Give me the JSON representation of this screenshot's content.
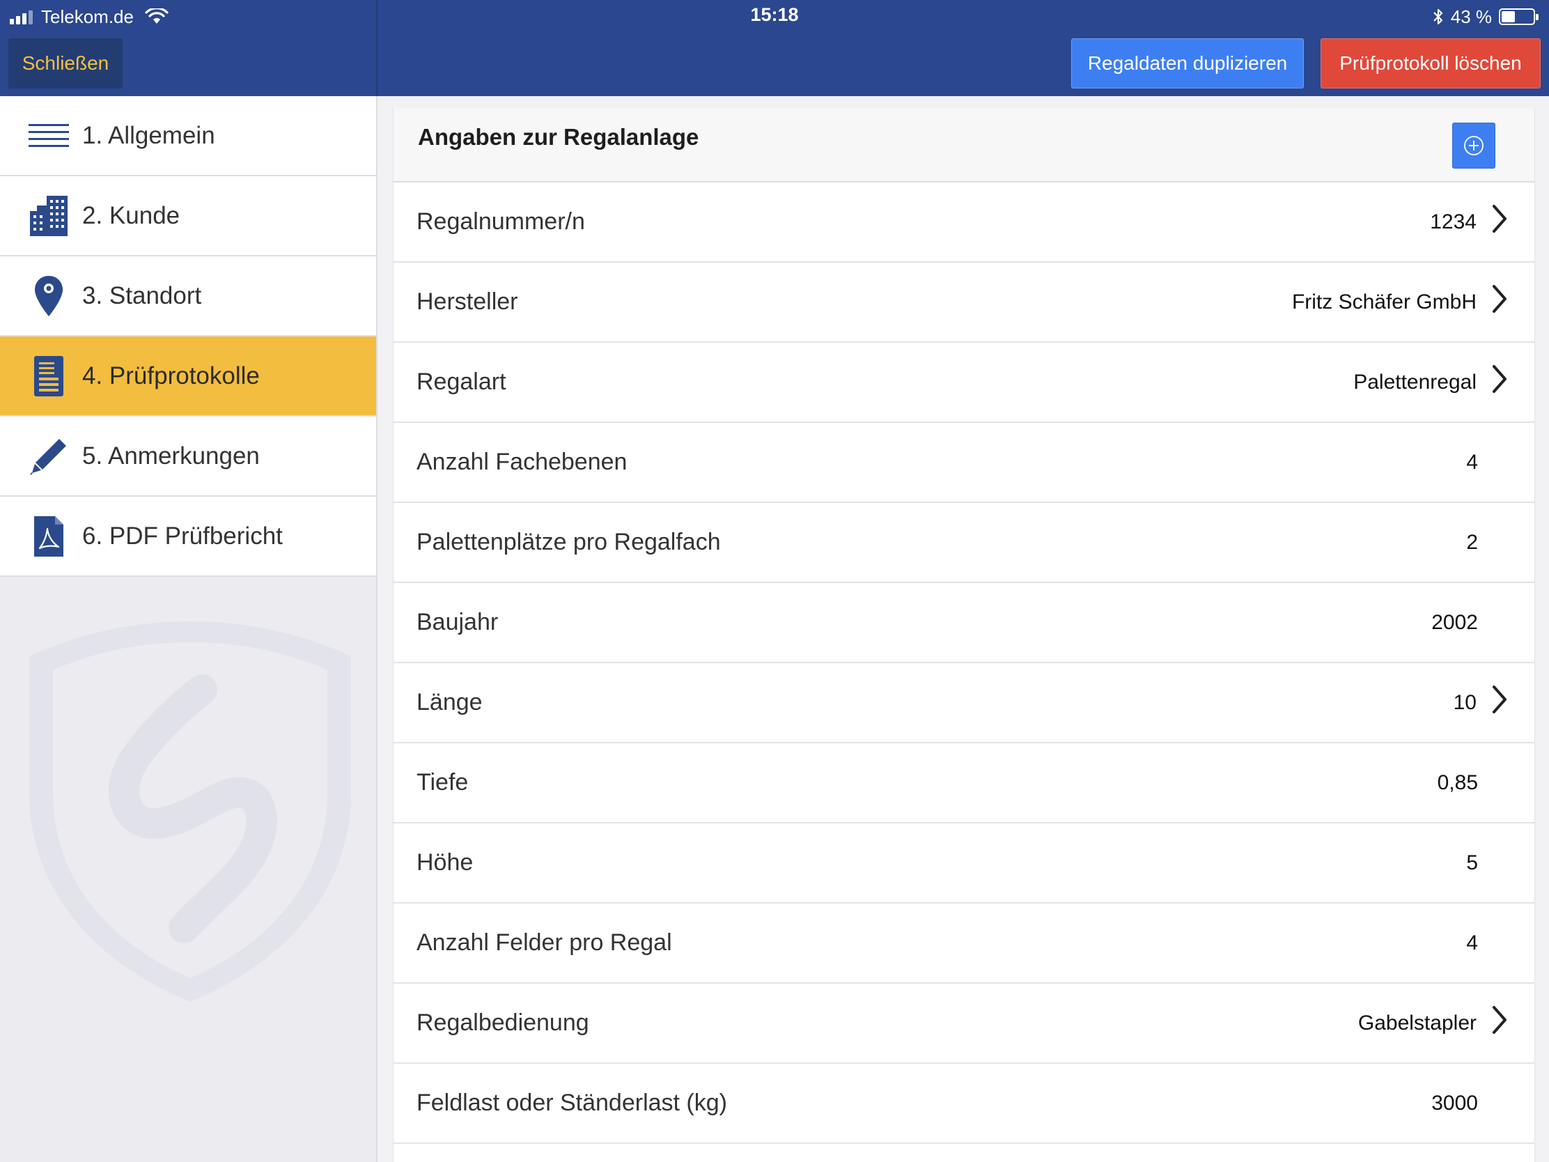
{
  "status_bar": {
    "carrier": "Telekom.de",
    "time": "15:18",
    "battery_text": "43 %",
    "battery_level": 0.43,
    "icons": [
      "signal-icon",
      "wifi-icon",
      "bluetooth-icon",
      "battery-icon"
    ]
  },
  "header": {
    "close_label": "Schließen",
    "duplicate_label": "Regaldaten duplizieren",
    "delete_label": "Prüfprotokoll löschen"
  },
  "sidebar": {
    "items": [
      {
        "label": "1. Allgemein",
        "icon": "menu-lines-icon",
        "active": false
      },
      {
        "label": "2. Kunde",
        "icon": "buildings-icon",
        "active": false
      },
      {
        "label": "3. Standort",
        "icon": "location-pin-icon",
        "active": false
      },
      {
        "label": "4. Prüfprotokolle",
        "icon": "document-icon",
        "active": true
      },
      {
        "label": "5. Anmerkungen",
        "icon": "pencil-icon",
        "active": false
      },
      {
        "label": "6. PDF Prüfbericht",
        "icon": "pdf-icon",
        "active": false
      }
    ]
  },
  "main": {
    "title": "Angaben zur Regalanlage",
    "rows": [
      {
        "label": "Regalnummer/n",
        "value": "1234",
        "has_arrow": true
      },
      {
        "label": "Hersteller",
        "value": "Fritz Schäfer GmbH",
        "has_arrow": true
      },
      {
        "label": "Regalart",
        "value": "Palettenregal",
        "has_arrow": true
      },
      {
        "label": "Anzahl Fachebenen",
        "value": "4",
        "has_arrow": false
      },
      {
        "label": "Palettenplätze pro Regalfach",
        "value": "2",
        "has_arrow": false
      },
      {
        "label": "Baujahr",
        "value": "2002",
        "has_arrow": false
      },
      {
        "label": "Länge",
        "value": "10",
        "has_arrow": true
      },
      {
        "label": "Tiefe",
        "value": "0,85",
        "has_arrow": false
      },
      {
        "label": "Höhe",
        "value": "5",
        "has_arrow": false
      },
      {
        "label": "Anzahl Felder pro Regal",
        "value": "4",
        "has_arrow": false
      },
      {
        "label": "Regalbedienung",
        "value": "Gabelstapler",
        "has_arrow": true
      },
      {
        "label": "Feldlast oder Ständerlast (kg)",
        "value": "3000",
        "has_arrow": false
      }
    ]
  },
  "colors": {
    "header_bg": "#2a478f",
    "accent_yellow": "#f3bd3f",
    "primary_blue": "#3d7ff2",
    "danger_red": "#e0483a",
    "icon_blue": "#2b4a8c"
  }
}
